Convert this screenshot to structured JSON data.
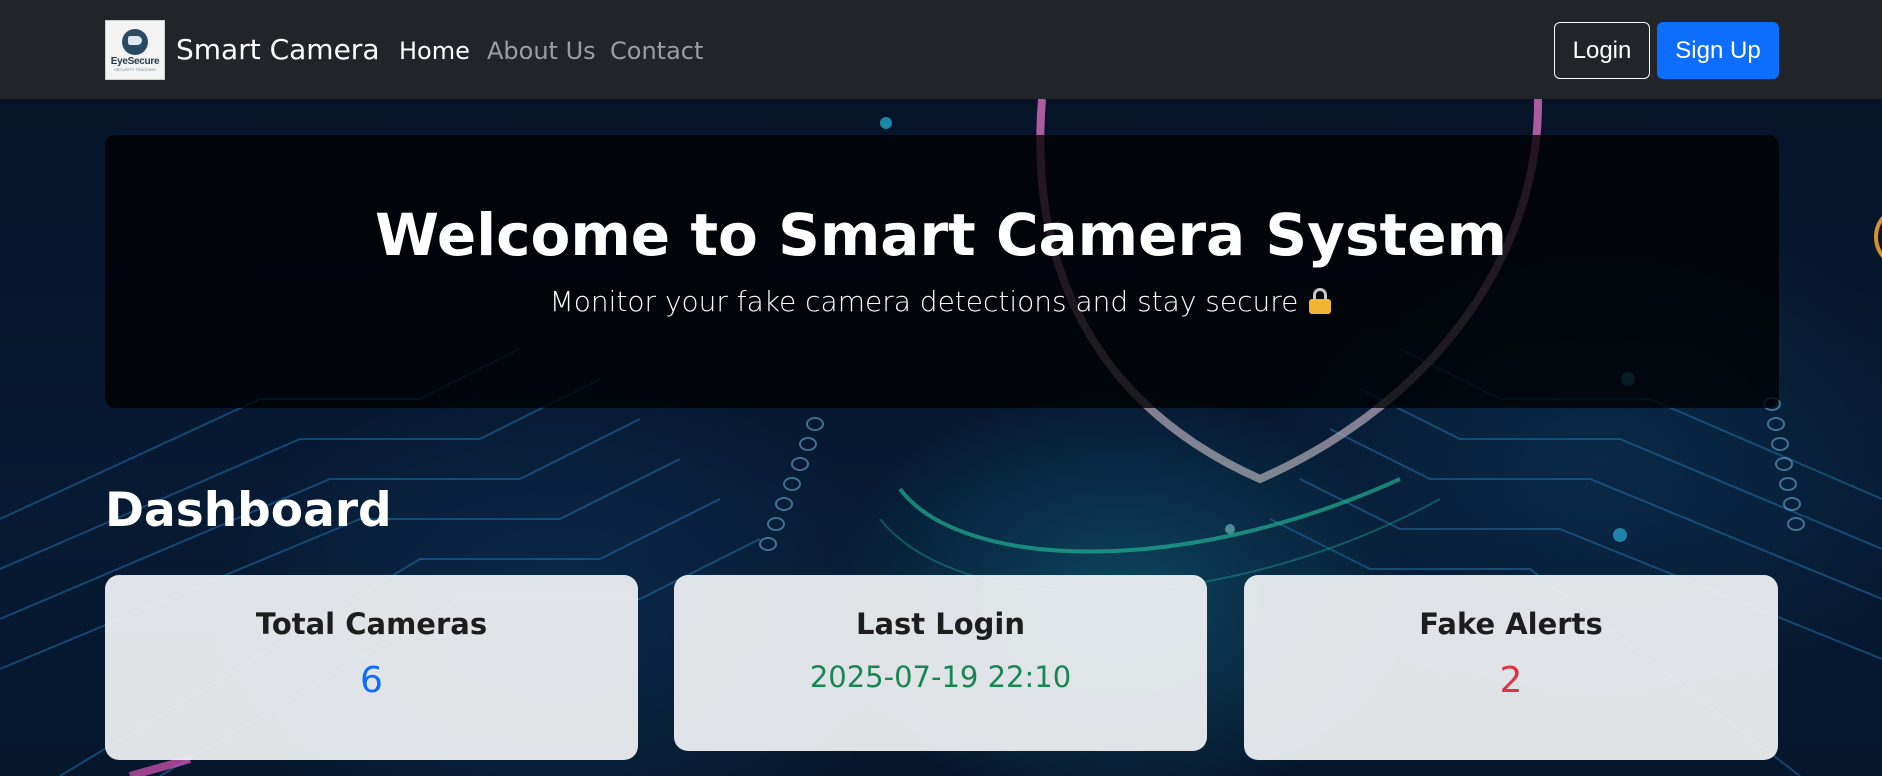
{
  "navbar": {
    "logo_text": "EyeSecure",
    "logo_subtext": "SECURITY TRACKING",
    "brand": "Smart Camera",
    "links": [
      {
        "label": "Home",
        "active": true
      },
      {
        "label": "About Us",
        "active": false
      },
      {
        "label": "Contact",
        "active": false
      }
    ],
    "login_label": "Login",
    "signup_label": "Sign Up"
  },
  "hero": {
    "title": "Welcome to Smart Camera System",
    "subtitle": "Monitor your fake camera detections and stay secure",
    "subtitle_icon": "lock-icon"
  },
  "dashboard": {
    "heading": "Dashboard",
    "cards": [
      {
        "title": "Total Cameras",
        "value": "6",
        "color": "#0d6efd"
      },
      {
        "title": "Last Login",
        "value": "2025-07-19 22:10",
        "color": "#198754"
      },
      {
        "title": "Fake Alerts",
        "value": "2",
        "color": "#dc3545"
      }
    ]
  },
  "colors": {
    "navbar_bg": "#212529",
    "primary": "#0d6efd",
    "success": "#198754",
    "danger": "#dc3545"
  }
}
